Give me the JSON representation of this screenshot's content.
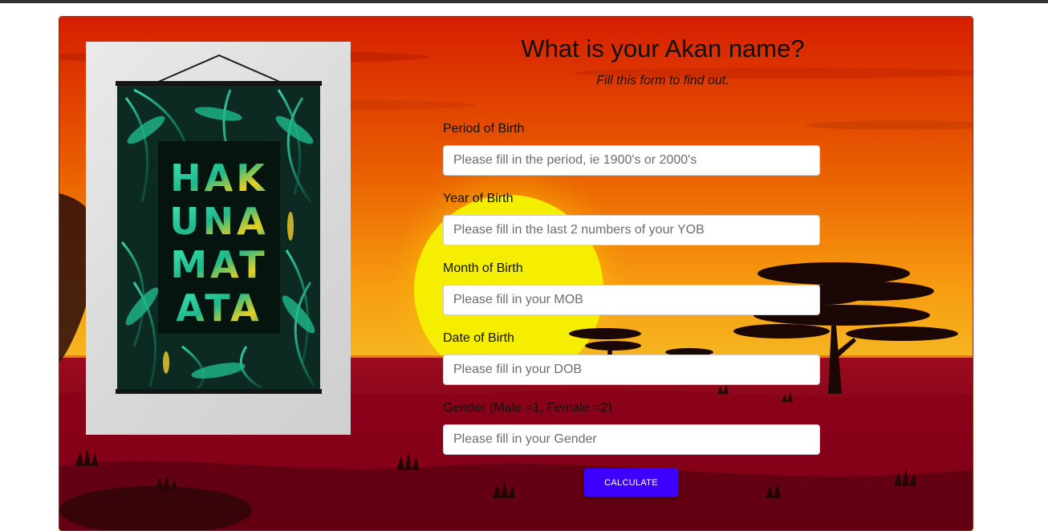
{
  "page": {
    "title": "What is your Akan name?",
    "subtitle": "Fill this form to find out."
  },
  "poster": {
    "text_lines": [
      "HAK",
      "UNA",
      "MAT",
      "ATA"
    ]
  },
  "form": {
    "fields": [
      {
        "label": "Period of Birth",
        "placeholder": "Please fill in the period, ie 1900's or 2000's",
        "value": ""
      },
      {
        "label": "Year of Birth",
        "placeholder": "Please fill in the last 2 numbers of your YOB",
        "value": ""
      },
      {
        "label": "Month of Birth",
        "placeholder": "Please fill in your MOB",
        "value": ""
      },
      {
        "label": "Date of Birth",
        "placeholder": "Please fill in your DOB",
        "value": ""
      },
      {
        "label": "Gender (Male =1, Female =2)",
        "placeholder": "Please fill in your Gender",
        "value": ""
      }
    ],
    "submit_label": "CALCULATE"
  },
  "colors": {
    "button": "#3d00ff",
    "sky_top": "#d61e00",
    "sky_mid": "#f27400",
    "sun": "#f5ee00",
    "ground": "#6e0016"
  }
}
